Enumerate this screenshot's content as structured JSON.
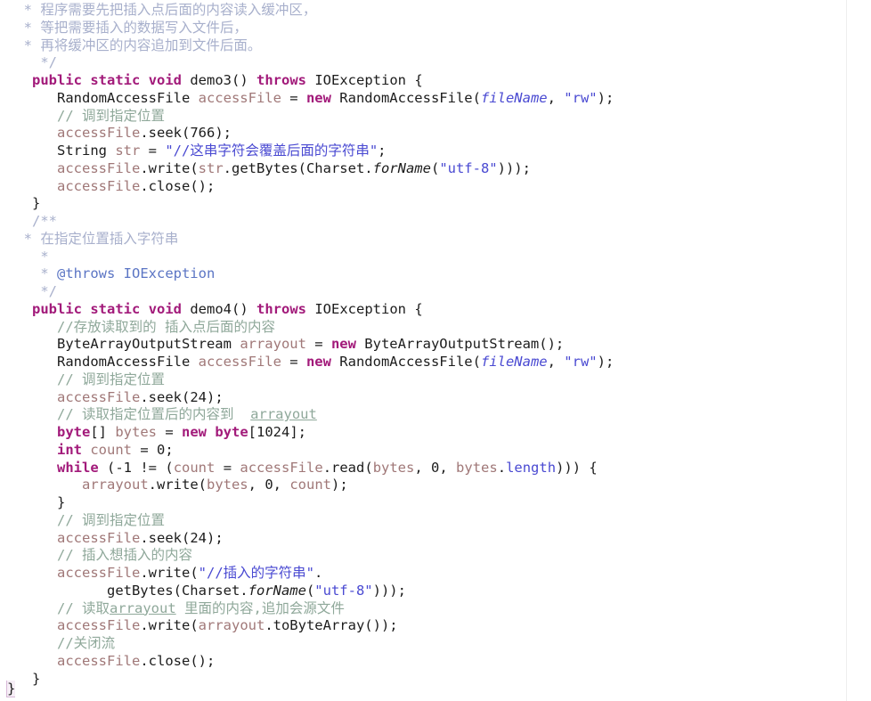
{
  "editor": {
    "app": "java-code-editor",
    "language": "Java",
    "background_color": "#ffffff",
    "font_size_px": 15.5,
    "line_height_px": 19.75,
    "margin_guide_color": "#eeeeee",
    "colors": {
      "keyword": "#a21a7a",
      "plain_text": "#1c1c1c",
      "local_variable": "#a07878",
      "field": "#4a4ad2",
      "static_field": "#4a4ad2",
      "static_method": "#1c1c1c",
      "string": "#4a4ad2",
      "line_comment": "#8fa89a",
      "doc_comment": "#a8b0cc",
      "doc_tag": "#5b75c4",
      "brace_match_background": "#f6eef6",
      "brace_match_border": "#d8b8d8"
    }
  },
  "code": {
    "lines": [
      {
        "id": "l1",
        "indent": 2,
        "text": "* 程序需要先把插入点后面的内容读入缓冲区，",
        "kind": "doc-comment"
      },
      {
        "id": "l2",
        "indent": 2,
        "text": "* 等把需要插入的数据写入文件后，",
        "kind": "doc-comment"
      },
      {
        "id": "l3",
        "indent": 2,
        "text": "* 再将缓冲区的内容追加到文件后面。",
        "kind": "doc-comment"
      },
      {
        "id": "l4",
        "indent": 3,
        "text": "*/",
        "kind": "doc-comment"
      },
      {
        "id": "l5",
        "indent": 3,
        "text": "public static void demo3() throws IOException {",
        "kind": "code"
      },
      {
        "id": "l6",
        "indent": 6,
        "text": "RandomAccessFile accessFile = new RandomAccessFile(fileName, \"rw\");",
        "kind": "code"
      },
      {
        "id": "l7",
        "indent": 6,
        "text": "// 调到指定位置",
        "kind": "line-comment"
      },
      {
        "id": "l8",
        "indent": 6,
        "text": "accessFile.seek(766);",
        "kind": "code"
      },
      {
        "id": "l9",
        "indent": 6,
        "text": "String str = \"//这串字符会覆盖后面的字符串\";",
        "kind": "code"
      },
      {
        "id": "l10",
        "indent": 6,
        "text": "accessFile.write(str.getBytes(Charset.forName(\"utf-8\")));",
        "kind": "code"
      },
      {
        "id": "l11",
        "indent": 6,
        "text": "accessFile.close();",
        "kind": "code"
      },
      {
        "id": "l12",
        "indent": 3,
        "text": "}",
        "kind": "code"
      },
      {
        "id": "l13",
        "indent": 3,
        "text": "/**",
        "kind": "doc-comment"
      },
      {
        "id": "l14",
        "indent": 2,
        "text": "* 在指定位置插入字符串",
        "kind": "doc-comment"
      },
      {
        "id": "l15",
        "indent": 4,
        "text": "*",
        "kind": "doc-comment"
      },
      {
        "id": "l16",
        "indent": 4,
        "text": "* @throws IOException",
        "kind": "doc-comment-tag"
      },
      {
        "id": "l17",
        "indent": 4,
        "text": "*/",
        "kind": "doc-comment"
      },
      {
        "id": "l18",
        "indent": 3,
        "text": "public static void demo4() throws IOException {",
        "kind": "code"
      },
      {
        "id": "l19",
        "indent": 6,
        "text": "//存放读取到的 插入点后面的内容",
        "kind": "line-comment"
      },
      {
        "id": "l20",
        "indent": 6,
        "text": "ByteArrayOutputStream arrayout = new ByteArrayOutputStream();",
        "kind": "code"
      },
      {
        "id": "l21",
        "indent": 6,
        "text": "RandomAccessFile accessFile = new RandomAccessFile(fileName, \"rw\");",
        "kind": "code"
      },
      {
        "id": "l22",
        "indent": 6,
        "text": "// 调到指定位置",
        "kind": "line-comment"
      },
      {
        "id": "l23",
        "indent": 6,
        "text": "accessFile.seek(24);",
        "kind": "code"
      },
      {
        "id": "l24",
        "indent": 6,
        "text": "// 读取指定位置后的内容到  arrayout",
        "kind": "line-comment"
      },
      {
        "id": "l25",
        "indent": 6,
        "text": "byte[] bytes = new byte[1024];",
        "kind": "code"
      },
      {
        "id": "l26",
        "indent": 6,
        "text": "int count = 0;",
        "kind": "code"
      },
      {
        "id": "l27",
        "indent": 6,
        "text": "while (-1 != (count = accessFile.read(bytes, 0, bytes.length))) {",
        "kind": "code"
      },
      {
        "id": "l28",
        "indent": 9,
        "text": "arrayout.write(bytes, 0, count);",
        "kind": "code"
      },
      {
        "id": "l29",
        "indent": 6,
        "text": "}",
        "kind": "code"
      },
      {
        "id": "l30",
        "indent": 6,
        "text": "// 调到指定位置",
        "kind": "line-comment"
      },
      {
        "id": "l31",
        "indent": 6,
        "text": "accessFile.seek(24);",
        "kind": "code"
      },
      {
        "id": "l32",
        "indent": 6,
        "text": "// 插入想插入的内容",
        "kind": "line-comment"
      },
      {
        "id": "l33",
        "indent": 6,
        "text": "accessFile.write(\"//插入的字符串\".",
        "kind": "code"
      },
      {
        "id": "l34",
        "indent": 12,
        "text": "getBytes(Charset.forName(\"utf-8\")));",
        "kind": "code"
      },
      {
        "id": "l35",
        "indent": 6,
        "text": "// 读取arrayout 里面的内容,追加会源文件",
        "kind": "line-comment"
      },
      {
        "id": "l36",
        "indent": 6,
        "text": "accessFile.write(arrayout.toByteArray());",
        "kind": "code"
      },
      {
        "id": "l37",
        "indent": 6,
        "text": "//关闭流",
        "kind": "line-comment"
      },
      {
        "id": "l38",
        "indent": 6,
        "text": "accessFile.close();",
        "kind": "code"
      },
      {
        "id": "l39",
        "indent": 3,
        "text": "}",
        "kind": "code"
      },
      {
        "id": "l40",
        "indent": 1,
        "text": "}",
        "kind": "code-brace-match"
      }
    ],
    "keywords": [
      "public",
      "static",
      "void",
      "throws",
      "new",
      "byte",
      "int",
      "while"
    ],
    "identifiers": {
      "methods": [
        "demo3",
        "demo4",
        "seek",
        "write",
        "close",
        "getBytes",
        "forName",
        "read",
        "toByteArray"
      ],
      "types": [
        "IOException",
        "RandomAccessFile",
        "String",
        "Charset",
        "ByteArrayOutputStream"
      ],
      "locals": [
        "accessFile",
        "str",
        "arrayout",
        "bytes",
        "count"
      ],
      "static_fields": [
        "fileName"
      ],
      "fields": [
        "length"
      ]
    },
    "strings": [
      "\"rw\"",
      "\"//这串字符会覆盖后面的字符串\"",
      "\"utf-8\"",
      "\"//插入的字符串\""
    ],
    "numbers": [
      "766",
      "24",
      "1024",
      "0",
      "-1"
    ],
    "highlighted_identifier": "arrayout"
  }
}
